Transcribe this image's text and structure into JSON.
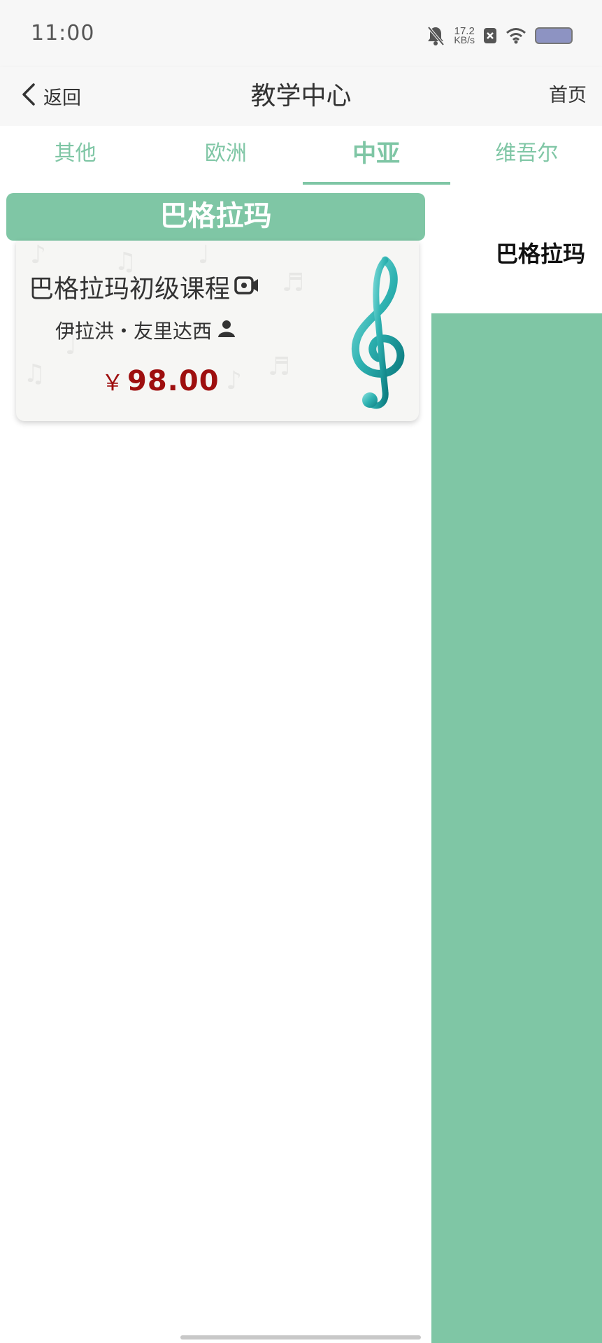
{
  "status_bar": {
    "time": "11:00",
    "speed_value": "17.2",
    "speed_unit": "KB/s",
    "icons": [
      "bell-muted-icon",
      "sim-off-icon",
      "wifi-icon",
      "battery-icon"
    ]
  },
  "header": {
    "back_label": "返回",
    "title": "教学中心",
    "home_label": "首页"
  },
  "tabs": [
    {
      "label": "其他",
      "active": false
    },
    {
      "label": "欧洲",
      "active": false
    },
    {
      "label": "中亚",
      "active": true
    },
    {
      "label": "维吾尔",
      "active": false
    }
  ],
  "content": {
    "category_title": "巴格拉玛",
    "course": {
      "title": "巴格拉玛初级课程",
      "teacher": "伊拉洪・友里达西",
      "currency": "￥",
      "price": "98.00",
      "icons": [
        "video-icon",
        "person-icon",
        "treble-clef-icon"
      ]
    }
  },
  "sidebar": {
    "items": [
      {
        "label": "巴格拉玛",
        "selected": true
      }
    ]
  },
  "colors": {
    "accent": "#7fc6a5",
    "price": "#9e0f0f",
    "battery": "#8d93c2"
  }
}
